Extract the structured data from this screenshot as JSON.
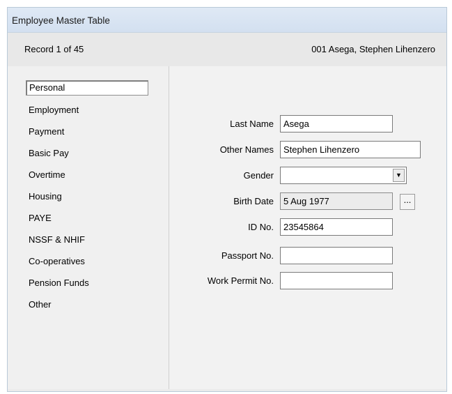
{
  "window": {
    "title": "Employee Master Table"
  },
  "record": {
    "count_text": "Record 1 of 45",
    "employee_text": "001  Asega, Stephen Lihenzero"
  },
  "nav": {
    "items": [
      {
        "label": "Personal",
        "selected": true
      },
      {
        "label": "Employment"
      },
      {
        "label": "Payment"
      },
      {
        "label": "Basic Pay"
      },
      {
        "label": "Overtime"
      },
      {
        "label": "Housing"
      },
      {
        "label": "PAYE"
      },
      {
        "label": "NSSF & NHIF"
      },
      {
        "label": "Co-operatives"
      },
      {
        "label": "Pension Funds"
      },
      {
        "label": "Other"
      }
    ]
  },
  "form": {
    "last_name": {
      "label": "Last Name",
      "value": "Asega"
    },
    "other_names": {
      "label": "Other Names",
      "value": "Stephen Lihenzero"
    },
    "gender": {
      "label": "Gender",
      "value": "",
      "arrow": "▼"
    },
    "birth_date": {
      "label": "Birth Date",
      "value": "5 Aug 1977",
      "button": "..."
    },
    "id_no": {
      "label": "ID No.",
      "value": "23545864"
    },
    "passport_no": {
      "label": "Passport No.",
      "value": ""
    },
    "work_permit_no": {
      "label": "Work Permit No.",
      "value": ""
    }
  }
}
